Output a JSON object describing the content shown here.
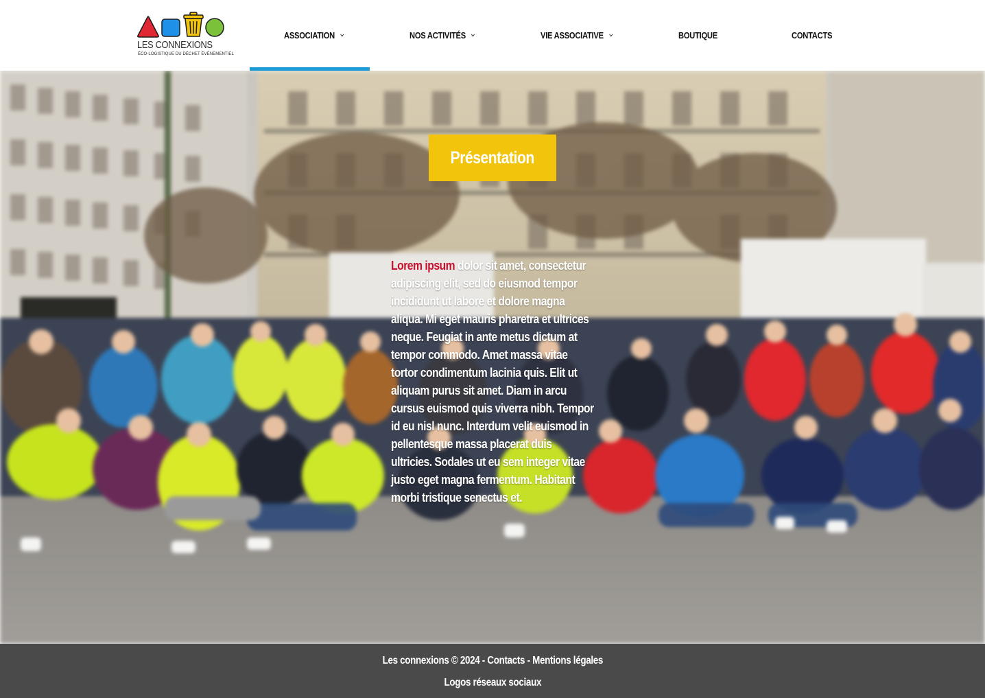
{
  "brand": {
    "name": "LES CONNEXIONS",
    "tagline": "ÉCO-LOGISTIQUE DU DÉCHET ÉVÉNEMENTIEL",
    "colors": {
      "red": "#e02834",
      "blue": "#1e90e8",
      "yellow": "#f2c40c",
      "green": "#7cc13a"
    }
  },
  "nav": {
    "items": [
      {
        "label": "ASSOCIATION",
        "dropdown": true,
        "active": true
      },
      {
        "label": "NOS ACTIVITÉS",
        "dropdown": true,
        "active": false
      },
      {
        "label": "VIE ASSOCIATIVE",
        "dropdown": true,
        "active": false
      },
      {
        "label": "BOUTIQUE",
        "dropdown": false,
        "active": false
      },
      {
        "label": "CONTACTS",
        "dropdown": false,
        "active": false
      }
    ],
    "active_color": "#1a9bd7"
  },
  "hero": {
    "button_label": "Présentation",
    "button_color": "#f2c40c",
    "text_lead": "Lorem ipsum",
    "text_body": " dolor sit amet, consectetur adipiscing elit, sed do eiusmod tempor incididunt ut labore et dolore magna aliqua. Mi eget mauris pharetra et ultrices neque. Feugiat in ante metus dictum at tempor commodo. Amet massa vitae tortor condimentum lacinia quis. Elit ut aliquam purus sit amet. Diam in arcu cursus euismod quis viverra nibh. Tempor id eu nisl nunc. Interdum velit euismod in pellentesque massa placerat duis ultricies. Sodales ut eu sem integer vitae justo eget magna fermentum. Habitant morbi tristique senectus et.",
    "lead_color": "#c8102e"
  },
  "footer": {
    "copyright": "Les connexions © 2024",
    "separator": " - ",
    "contacts_link": "Contacts",
    "legal_link": "Mentions légales",
    "social": "Logos réseaux sociaux"
  }
}
